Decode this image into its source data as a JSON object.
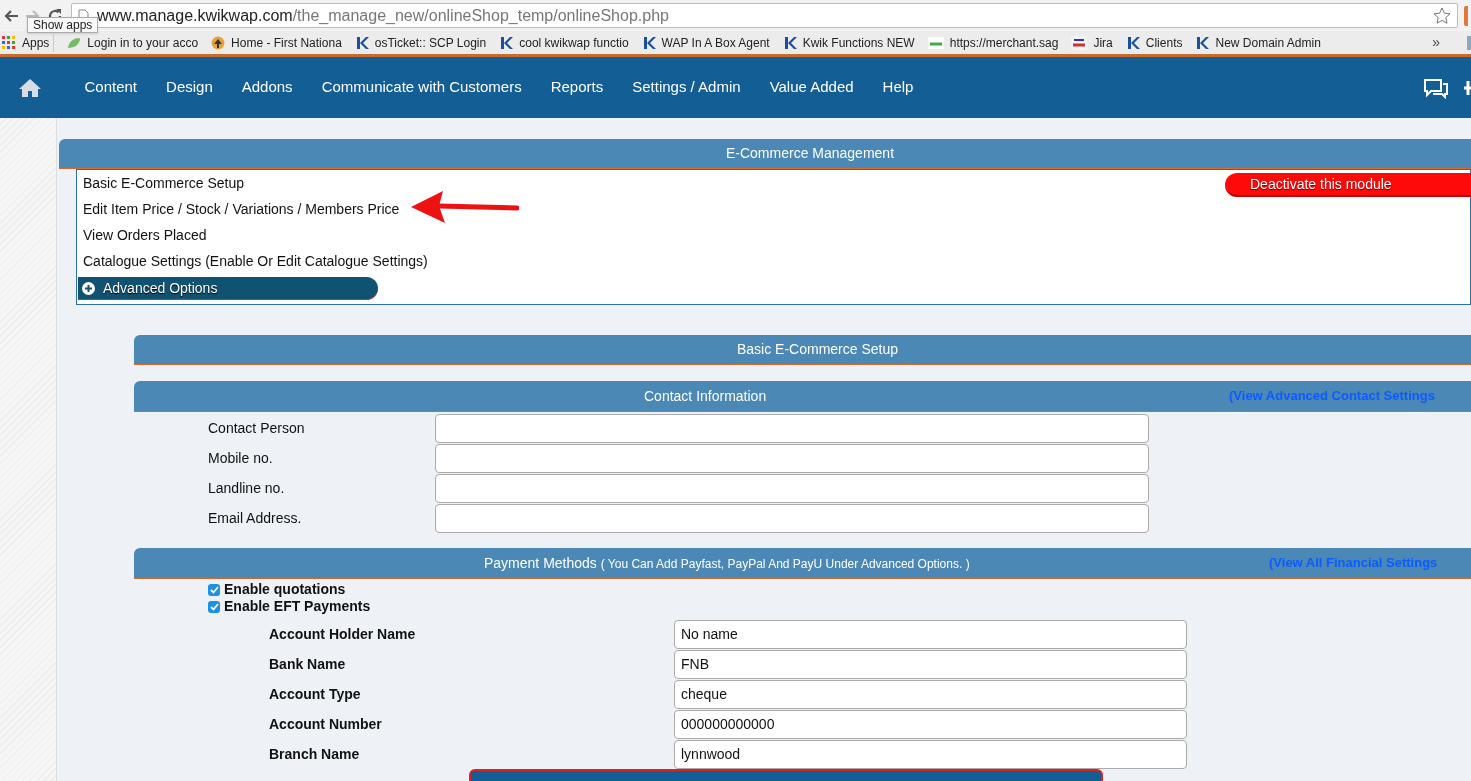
{
  "browser": {
    "url_host": "www.manage.kwikwap.com",
    "url_path": "/the_manage_new/onlineShop_temp/onlineShop.php",
    "tooltip": "Show apps",
    "bookmarks": [
      {
        "label": "Apps",
        "kind": "apps"
      },
      {
        "label": "Login in to your acco",
        "kind": "leaf"
      },
      {
        "label": "Home - First Nationa",
        "kind": "tree"
      },
      {
        "label": "osTicket:: SCP Login",
        "kind": "k"
      },
      {
        "label": "cool kwikwap functio",
        "kind": "k"
      },
      {
        "label": "WAP In A Box Agent",
        "kind": "k"
      },
      {
        "label": "Kwik Functions NEW",
        "kind": "k"
      },
      {
        "label": "https://merchant.sag",
        "kind": "sage"
      },
      {
        "label": "Jira",
        "kind": "jira"
      },
      {
        "label": "Clients",
        "kind": "k"
      },
      {
        "label": "New Domain Admin",
        "kind": "k"
      }
    ],
    "overflow": "»"
  },
  "nav": {
    "items": [
      "Content",
      "Design",
      "Addons",
      "Communicate with Customers",
      "Reports",
      "Settings / Admin",
      "Value Added",
      "Help"
    ]
  },
  "ecommerce": {
    "title": "E-Commerce Management",
    "links": [
      "Basic E-Commerce Setup",
      "Edit Item Price / Stock / Variations / Members Price",
      "View Orders Placed",
      "Catalogue Settings (Enable Or Edit Catalogue Settings)"
    ],
    "deactivate_button": "Deactivate this module",
    "advanced_button": "Advanced Options"
  },
  "setup_title": "Basic E-Commerce Setup",
  "contact": {
    "title": "Contact Information",
    "link": "(View Advanced Contact Settings",
    "fields": [
      {
        "label": "Contact Person"
      },
      {
        "label": "Mobile no."
      },
      {
        "label": "Landline no."
      },
      {
        "label": "Email Address."
      }
    ]
  },
  "payment": {
    "title": "Payment Methods",
    "note": "( You Can Add Payfast, PayPal And PayU Under Advanced Options. )",
    "link": "(View All Financial Settings",
    "options": [
      {
        "label": "Enable quotations",
        "checked": true
      },
      {
        "label": "Enable EFT Payments",
        "checked": true
      }
    ],
    "fields": [
      {
        "label": "Account Holder Name",
        "value": "No name"
      },
      {
        "label": "Bank Name",
        "value": "FNB"
      },
      {
        "label": "Account Type",
        "value": "cheque"
      },
      {
        "label": "Account Number",
        "value": "000000000000"
      },
      {
        "label": "Branch Name",
        "value": "lynnwood"
      }
    ]
  }
}
